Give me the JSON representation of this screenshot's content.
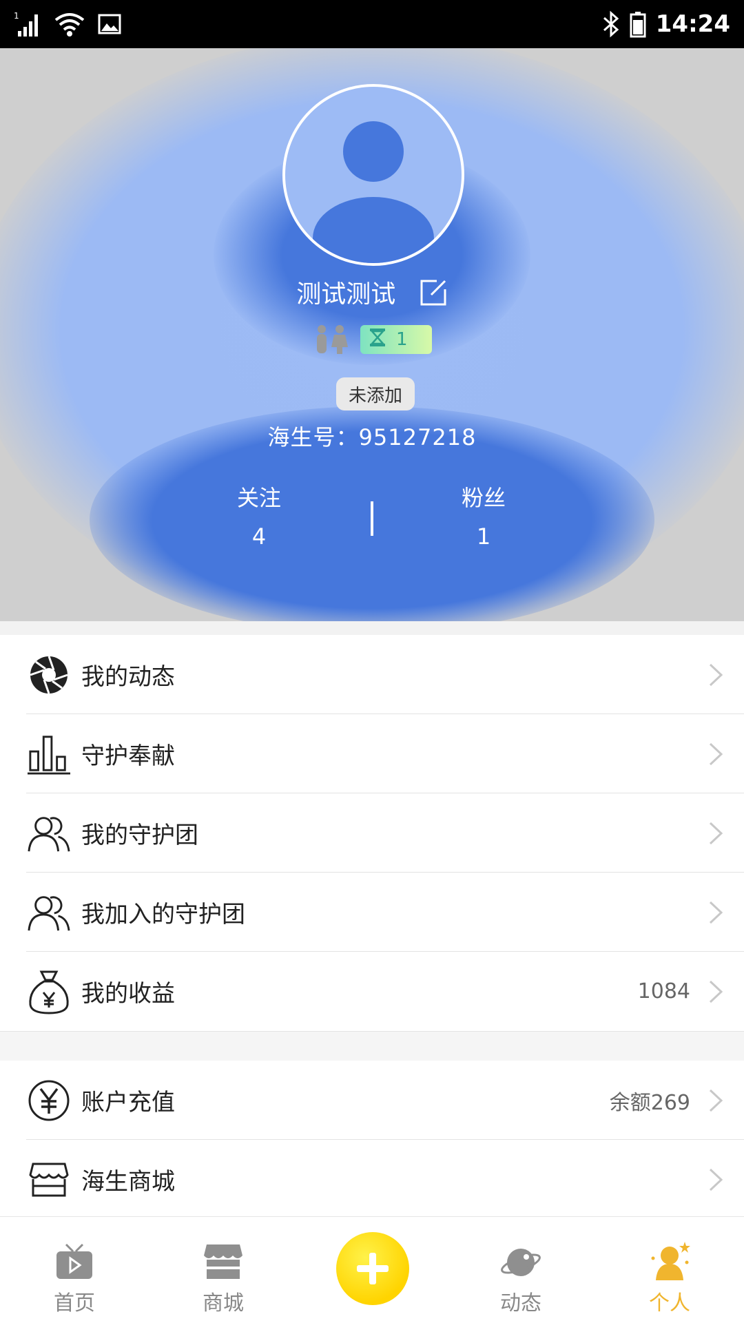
{
  "status_bar": {
    "signal_label": "1",
    "time": "14:24",
    "icons": [
      "signal-icon",
      "wifi-icon",
      "image-icon",
      "bluetooth-icon",
      "battery-icon"
    ]
  },
  "profile": {
    "username": "测试测试",
    "level_badge": "1",
    "tag": "未添加",
    "id_line": "海生号：95127218",
    "follow_label": "关注",
    "follow_count": "4",
    "fans_label": "粉丝",
    "fans_count": "1"
  },
  "menu_group1": [
    {
      "label": "我的动态",
      "icon": "aperture-icon",
      "value": ""
    },
    {
      "label": "守护奉献",
      "icon": "bar-chart-icon",
      "value": ""
    },
    {
      "label": "我的守护团",
      "icon": "group-icon",
      "value": ""
    },
    {
      "label": "我加入的守护团",
      "icon": "group-icon",
      "value": ""
    },
    {
      "label": "我的收益",
      "icon": "money-bag-icon",
      "value": "1084"
    }
  ],
  "menu_group2": [
    {
      "label": "账户充值",
      "icon": "yuan-coin-icon",
      "value": "余额269"
    },
    {
      "label": "海生商城",
      "icon": "store-icon",
      "value": ""
    }
  ],
  "bottom_nav": [
    {
      "label": "首页",
      "icon": "tv-play-icon"
    },
    {
      "label": "商城",
      "icon": "shop-icon"
    },
    {
      "label": "动态",
      "icon": "planet-icon"
    },
    {
      "label": "个人",
      "icon": "person-star-icon",
      "active": true
    }
  ],
  "colors": {
    "header_light": "#9dbbf5",
    "header_dark": "#4677dc",
    "accent_yellow": "#ffd400",
    "active_nav": "#f0b52e"
  }
}
